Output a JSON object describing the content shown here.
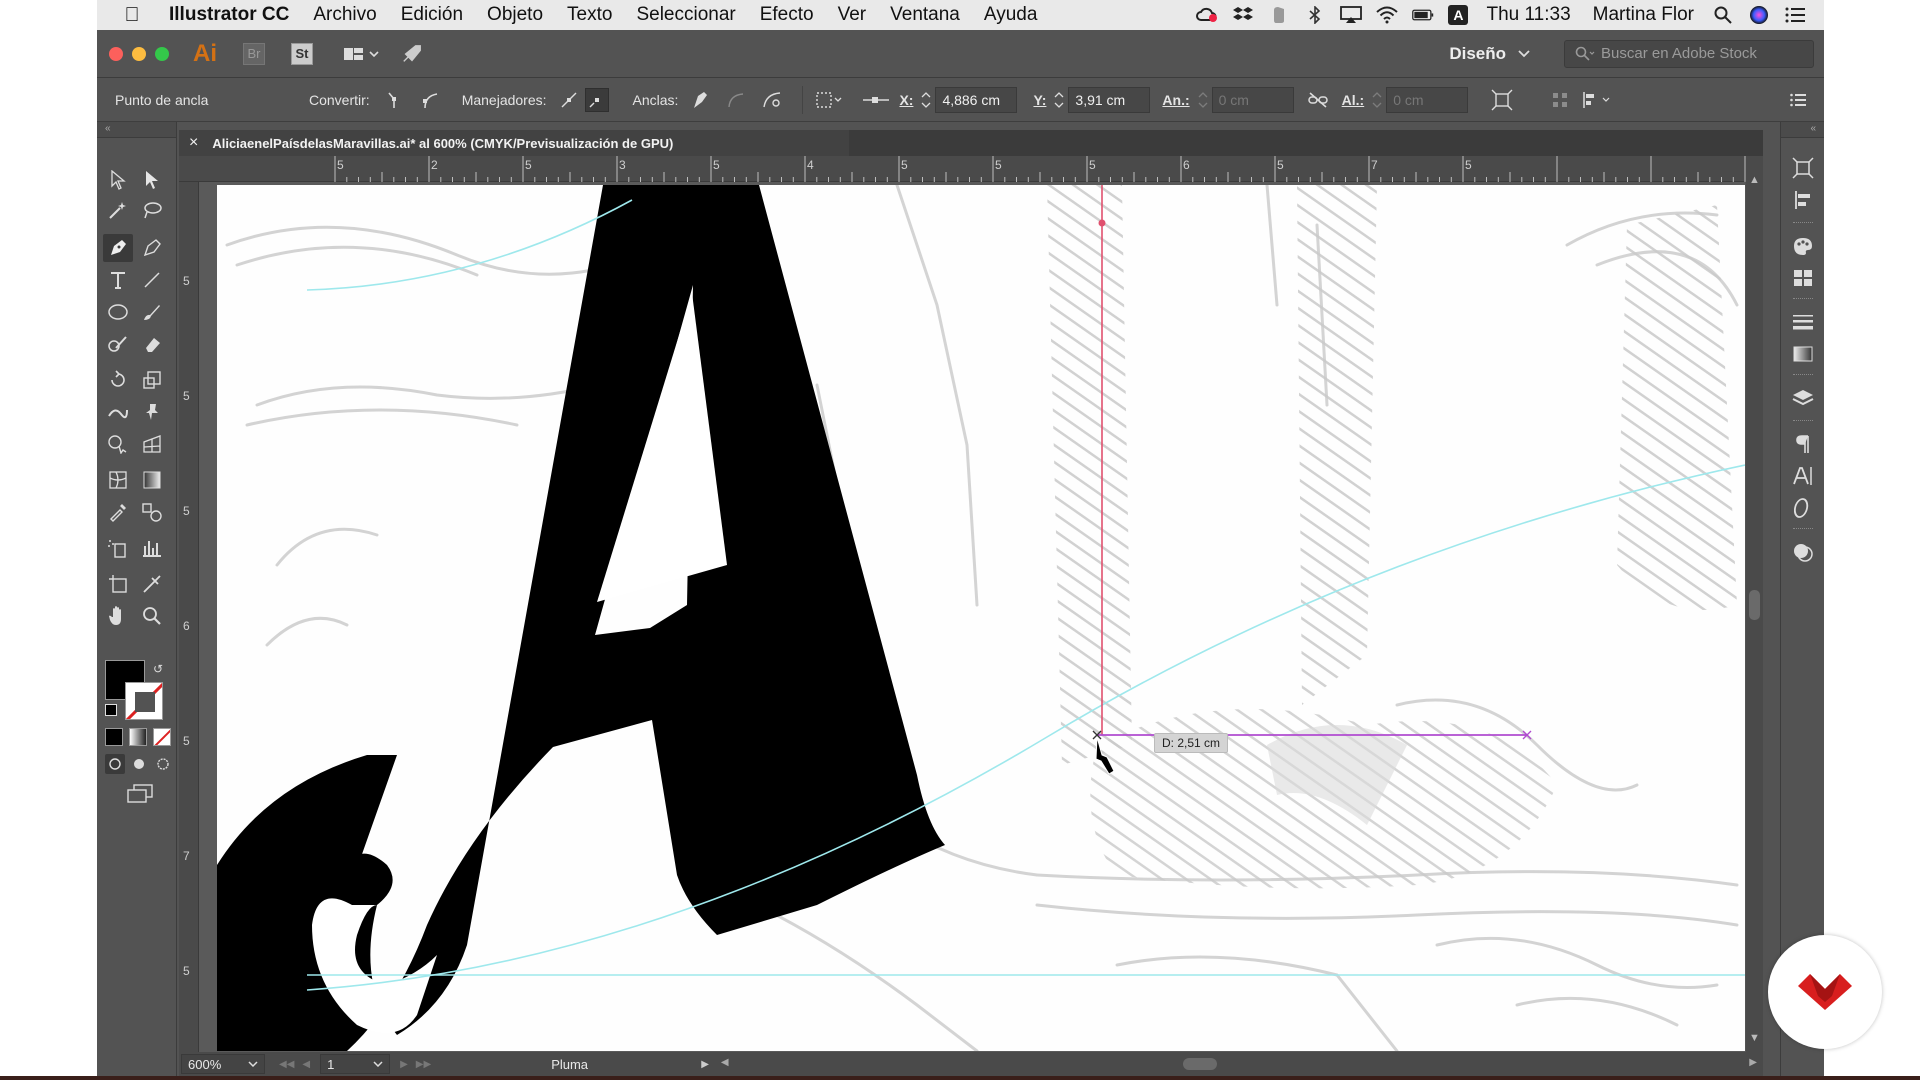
{
  "menubar": {
    "app_name": "Illustrator CC",
    "items": [
      "Archivo",
      "Edición",
      "Objeto",
      "Texto",
      "Seleccionar",
      "Efecto",
      "Ver",
      "Ventana",
      "Ayuda"
    ],
    "clock": "Thu 11:33",
    "user": "Martina Flor",
    "status_icons": [
      "creative-cloud-icon",
      "dropbox-icon",
      "evernote-icon",
      "bluetooth-icon",
      "airplay-icon",
      "wifi-icon",
      "battery-icon",
      "input-source-icon"
    ],
    "input_source": "A"
  },
  "appbar": {
    "logo": "Ai",
    "bridge": "Br",
    "stock": "St",
    "workspace": "Diseño",
    "search_placeholder": "Buscar en Adobe Stock"
  },
  "controlbar": {
    "selection_label": "Punto de ancla",
    "convert_label": "Convertir:",
    "handles_label": "Manejadores:",
    "anchors_label": "Anclas:",
    "x_label": "X:",
    "x_value": "4,886 cm",
    "y_label": "Y:",
    "y_value": "3,91 cm",
    "w_label": "An.:",
    "w_value": "0 cm",
    "h_label": "Al.:",
    "h_value": "0 cm"
  },
  "document": {
    "tab_title": "AliciaenelPaísdelasMaravillas.ai* al 600% (CMYK/Previsualización de GPU)",
    "close_glyph": "×",
    "ruler_h_labels": [
      "5",
      "2",
      "5",
      "3",
      "5",
      "4",
      "5",
      "5",
      "5",
      "6",
      "5",
      "7",
      "5"
    ],
    "ruler_v_labels": [
      "5",
      "5",
      "5",
      "6",
      "5",
      "7",
      "5"
    ],
    "measure_tooltip": "D: 2,51 cm",
    "letter": "A"
  },
  "statusbar": {
    "zoom": "600%",
    "artboard": "1",
    "tool_name": "Pluma"
  },
  "colors": {
    "app_bg": "#535353",
    "accent_orange": "#ff7c00",
    "guide_cyan": "#9ee8ec",
    "guide_pink": "#e0506e",
    "measure_purple": "#b04bd0",
    "brand_red": "#d81e1e"
  }
}
